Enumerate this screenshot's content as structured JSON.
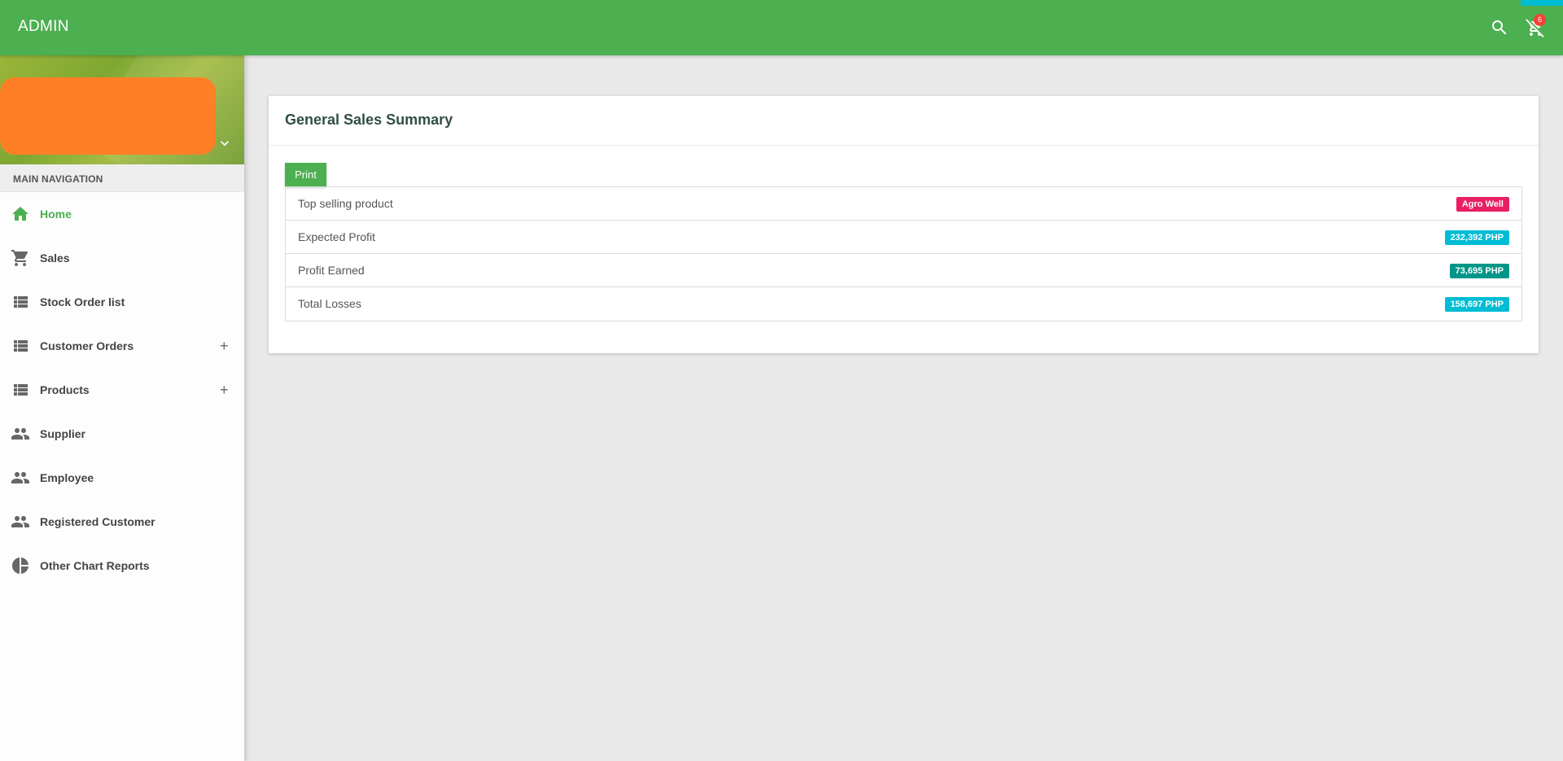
{
  "header": {
    "brand": "ADMIN",
    "cart_count": "6",
    "search_icon": "search-icon",
    "cart_icon": "remove-shopping-cart-icon"
  },
  "sidebar": {
    "section_title": "MAIN NAVIGATION",
    "items": [
      {
        "label": "Home",
        "icon": "home-icon",
        "active": true,
        "expandable": false
      },
      {
        "label": "Sales",
        "icon": "shopping-cart-icon",
        "active": false,
        "expandable": false
      },
      {
        "label": "Stock Order list",
        "icon": "view-list-icon",
        "active": false,
        "expandable": false
      },
      {
        "label": "Customer Orders",
        "icon": "view-list-icon",
        "active": false,
        "expandable": true
      },
      {
        "label": "Products",
        "icon": "view-list-icon",
        "active": false,
        "expandable": true
      },
      {
        "label": "Supplier",
        "icon": "people-icon",
        "active": false,
        "expandable": false
      },
      {
        "label": "Employee",
        "icon": "people-icon",
        "active": false,
        "expandable": false
      },
      {
        "label": "Registered Customer",
        "icon": "people-icon",
        "active": false,
        "expandable": false
      },
      {
        "label": "Other Chart Reports",
        "icon": "pie-chart-icon",
        "active": false,
        "expandable": false
      }
    ],
    "expand_symbol": "+"
  },
  "main": {
    "card_title": "General Sales Summary",
    "print_label": "Print",
    "summary": [
      {
        "label": "Top selling product",
        "value": "Agro Well",
        "color": "#e91e63"
      },
      {
        "label": "Expected Profit",
        "value": "232,392 PHP",
        "color": "#00bcd4"
      },
      {
        "label": "Profit Earned",
        "value": "73,695 PHP",
        "color": "#009688"
      },
      {
        "label": "Total Losses",
        "value": "158,697 PHP",
        "color": "#00bcd4"
      }
    ]
  },
  "colors": {
    "primary": "#4caf50",
    "accent": "#00bcd4",
    "user_block": "#ff7f27"
  }
}
